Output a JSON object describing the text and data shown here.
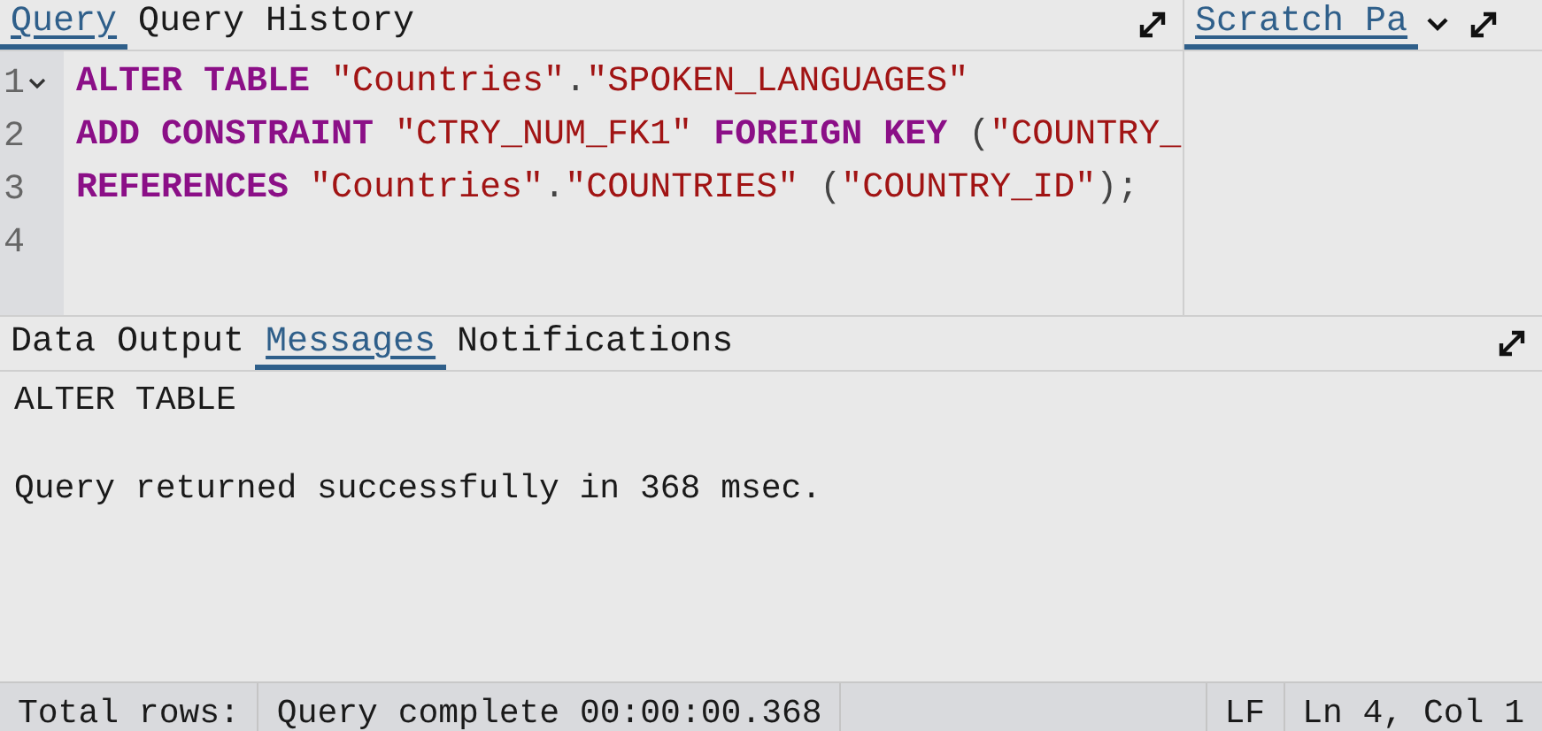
{
  "editor_tabs": [
    {
      "label": "Query",
      "selected": true
    },
    {
      "label": "Query History",
      "selected": false
    }
  ],
  "editor": {
    "lines": [
      {
        "number": "1",
        "foldable": true,
        "tokens": [
          {
            "kind": "keyword",
            "text": "ALTER TABLE"
          },
          {
            "kind": "string",
            "text": "\"Countries\"",
            "space_before": true
          },
          {
            "kind": "plain",
            "text": "."
          },
          {
            "kind": "string",
            "text": "\"SPOKEN_LANGUAGES\""
          }
        ]
      },
      {
        "number": "2",
        "foldable": false,
        "tokens": [
          {
            "kind": "keyword",
            "text": "ADD CONSTRAINT"
          },
          {
            "kind": "string",
            "text": "\"CTRY_NUM_FK1\"",
            "space_before": true
          },
          {
            "kind": "keyword",
            "text": "FOREIGN KEY",
            "space_before": true
          },
          {
            "kind": "plain",
            "text": "(",
            "space_before": true
          },
          {
            "kind": "string",
            "text": "\"COUNTRY_"
          }
        ]
      },
      {
        "number": "3",
        "foldable": false,
        "tokens": [
          {
            "kind": "keyword",
            "text": "REFERENCES"
          },
          {
            "kind": "string",
            "text": "\"Countries\"",
            "space_before": true
          },
          {
            "kind": "plain",
            "text": "."
          },
          {
            "kind": "string",
            "text": "\"COUNTRIES\""
          },
          {
            "kind": "plain",
            "text": "(",
            "space_before": true
          },
          {
            "kind": "string",
            "text": "\"COUNTRY_ID\""
          },
          {
            "kind": "plain",
            "text": ");"
          }
        ]
      },
      {
        "number": "4",
        "foldable": false
      }
    ]
  },
  "scratch_tabs": [
    {
      "label": "Scratch Pa",
      "selected": true
    }
  ],
  "output_tabs": [
    {
      "label": "Data Output",
      "selected": false
    },
    {
      "label": "Messages",
      "selected": true
    },
    {
      "label": "Notifications",
      "selected": false
    }
  ],
  "messages": [
    "ALTER TABLE",
    "Query returned successfully in 368 msec."
  ],
  "status_bar": {
    "total_rows": "Total rows:",
    "query_status": "Query complete 00:00:00.368",
    "line_ending": "LF",
    "cursor": "Ln 4, Col 1"
  }
}
